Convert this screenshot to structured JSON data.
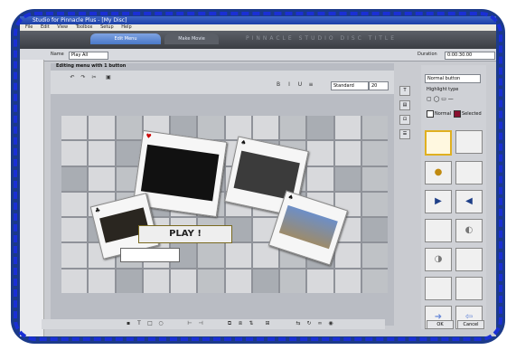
{
  "window": {
    "title": "Studio for Pinnacle Plus - [My Disc]",
    "menu": [
      "File",
      "Edit",
      "View",
      "Toolbox",
      "Setup",
      "Help"
    ]
  },
  "tabs": [
    {
      "label": "Edit Menu",
      "active": true
    },
    {
      "label": "Make Movie",
      "active": false
    }
  ],
  "banner": "PINNACLE STUDIO DISC TITLE",
  "title_row": {
    "name_label": "Name",
    "name_value": "Play All",
    "duration_label": "Duration",
    "duration_value": "0:00:30.00"
  },
  "editor": {
    "heading": "Editing menu with 1 button",
    "font": "Standard",
    "size": "20",
    "play_text": "PLAY !"
  },
  "right_panel": {
    "style": "Normal button",
    "highlight_label": "Highlight type",
    "colors": [
      {
        "label": "Normal",
        "color": "#ffffff"
      },
      {
        "label": "Selected",
        "color": "#8a1030"
      }
    ],
    "thumb_icons": [
      "",
      "",
      "●",
      "",
      "▶",
      "◀",
      "",
      "◐",
      "◑",
      "",
      "",
      "",
      "➜",
      "⇦"
    ]
  },
  "buttons": {
    "ok": "OK",
    "cancel": "Cancel"
  }
}
